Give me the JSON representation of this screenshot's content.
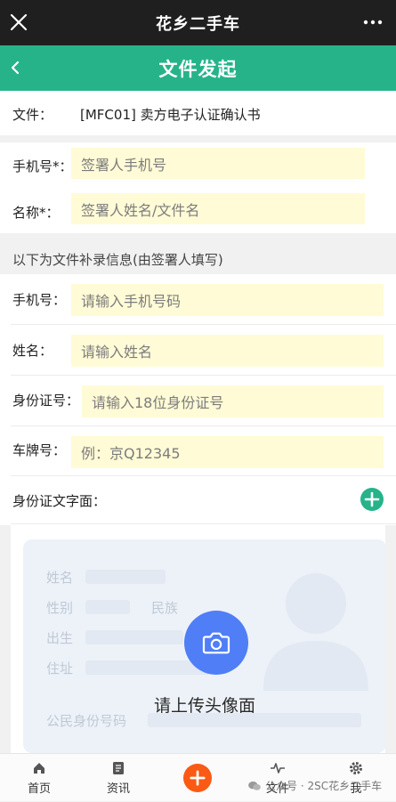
{
  "app": {
    "window_title": "花乡二手车",
    "page_title": "文件发起"
  },
  "document": {
    "label": "文件：",
    "value": "[MFC01] 卖方电子认证确认书"
  },
  "signer": {
    "phone_label": "手机号*：",
    "phone_placeholder": "签署人手机号",
    "name_label": "名称*：",
    "name_placeholder": "签署人姓名/文件名"
  },
  "supplement": {
    "section_title": "以下为文件补录信息(由签署人填写)",
    "phone_label": "手机号：",
    "phone_placeholder": "请输入手机号码",
    "name_label": "姓名：",
    "name_placeholder": "请输入姓名",
    "id_label": "身份证号：",
    "id_placeholder": "请输入18位身份证号",
    "plate_label": "车牌号：",
    "plate_placeholder": "例：京Q12345",
    "id_front_label": "身份证文字面："
  },
  "id_card": {
    "field_name": "姓名",
    "field_gender": "性别",
    "field_ethnicity": "民族",
    "field_birth": "出生",
    "field_address": "住址",
    "field_id_number": "公民身份号码",
    "upload_text": "请上传头像面"
  },
  "nav": {
    "items": [
      {
        "label": "首页",
        "icon": "home-icon"
      },
      {
        "label": "资讯",
        "icon": "news-icon"
      },
      {
        "label": "文件",
        "icon": "pulse-icon"
      },
      {
        "label": "我",
        "icon": "gear-icon"
      }
    ]
  },
  "watermark": {
    "text": "公众号 · 2SC花乡二手车"
  },
  "colors": {
    "top_bar": "#1f1f1f",
    "header": "#26b38a",
    "input_bg": "#fffbd6",
    "add_button": "#26b38a",
    "camera_button": "#4f7ef7",
    "center_plus": "#fa5a14"
  }
}
